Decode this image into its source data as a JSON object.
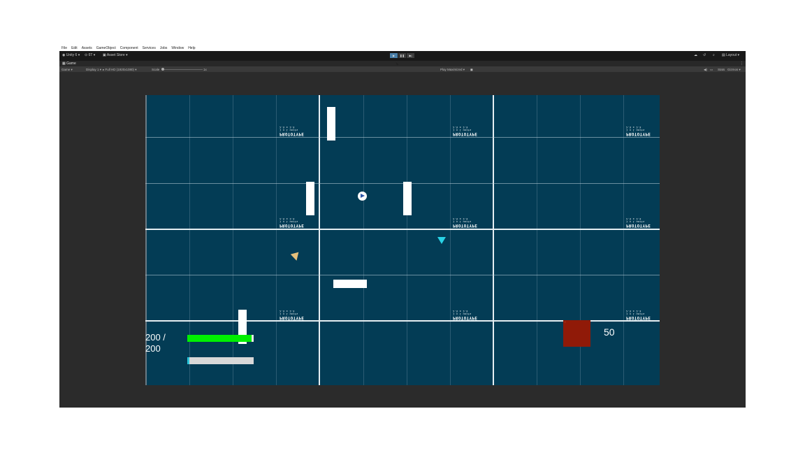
{
  "menu": [
    "File",
    "Edit",
    "Assets",
    "GameObject",
    "Component",
    "Services",
    "Jobs",
    "Window",
    "Help"
  ],
  "toolbar": {
    "account": "Unity 6",
    "collab": "6T",
    "asset_store": "Asset Store",
    "layout": "Layout"
  },
  "tabs": {
    "game": "Game"
  },
  "gamebar": {
    "view": "Game",
    "display": "Display 1",
    "resolution": "Full HD (1920x1080)",
    "scale_label": "Scale",
    "scale_value": "1x",
    "play_mode": "Play Maximized",
    "stats": "Stats",
    "gizmos": "Gizmos"
  },
  "prototype": {
    "label": "PROTOTYPE",
    "sub1": "2.5 x 2.5",
    "sub2": "1 x 1 units"
  },
  "hud": {
    "health_text": "200 /\n200",
    "health_fraction": 1.0,
    "xp_fraction": 0.03,
    "score": "50"
  },
  "colors": {
    "background": "#033c55",
    "health": "#00f000",
    "xp_fill": "#2ac3d8",
    "enemy_box": "#901a08",
    "enemy_triangle_cyan": "#29d3e6",
    "enemy_triangle_tan": "#e5c07b"
  },
  "icons": {
    "play": "play-icon",
    "pause": "pause-icon",
    "step": "step-icon"
  }
}
